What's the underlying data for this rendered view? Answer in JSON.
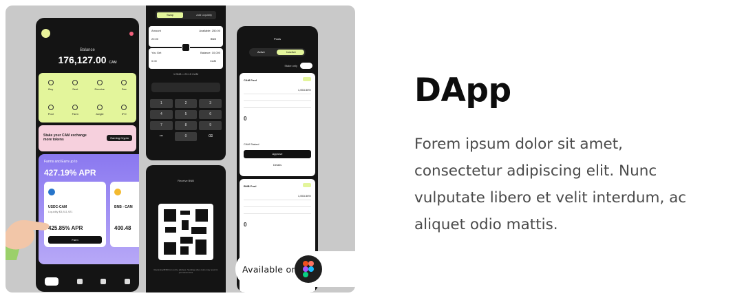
{
  "card": {
    "title": "DApp",
    "description": "Forem ipsum dolor sit amet, consectetur adipiscing elit. Nunc vulputate libero et velit interdum, ac aliquet odio mattis.",
    "available_on": "Available on",
    "available_icon": "figma-icon"
  },
  "wallet": {
    "balance_label": "Balance",
    "balance_value": "176,127.00",
    "balance_unit": "CAM",
    "actions": [
      "Buy",
      "Sent",
      "Receive",
      "Dex",
      "Pool",
      "Farm",
      "Jungle",
      "IFO"
    ],
    "stake_text": "Stake your CAM exchange more tokens",
    "stake_button": "Earning Crypto",
    "farm_heading": "Farms and Earn up to",
    "farm_apr": "427.19% APR",
    "pools": [
      {
        "name": "USDC-CAM",
        "liquidity": "Liquidity $3,811,921",
        "apr": "425.85% APR",
        "button": "Farm"
      },
      {
        "name": "BNB - CAM",
        "liquidity": "",
        "apr": "400.48",
        "button": ""
      }
    ]
  },
  "swap": {
    "tabs": [
      "Swap",
      "Add Liquidity"
    ],
    "from_label": "Amount",
    "from_available": "Available: 250.00",
    "from_value": "20.00",
    "from_token": "BNB",
    "to_label": "You Get",
    "to_balance": "Balance: 10,000",
    "to_value": "0.00",
    "to_token": "CAM",
    "rate": "1 BNB = 20.15 CAM",
    "keys": [
      "1",
      "2",
      "3",
      "4",
      "5",
      "6",
      "7",
      "8",
      "9",
      "•••",
      "0",
      "⌫"
    ]
  },
  "receive": {
    "title": "Receive BNB",
    "note": "Receiving BNB from to the address. Sending other coins may result in permanent loss"
  },
  "pools_screen": {
    "title": "Pools",
    "tabs": [
      "Active",
      "Inactive"
    ],
    "toggle_label": "Stake only",
    "pool_a": {
      "name": "CAM Pool",
      "apr": "1,053.56%",
      "earned": "0",
      "staked_label": "CAM Staked",
      "approve": "Approve",
      "details": "Details"
    },
    "pool_b": {
      "name": "BNB Pool",
      "apr": "1,053.56%",
      "earned": "0"
    }
  },
  "colors": {
    "accent_lime": "#e3f59b",
    "accent_pink": "#f6d0dd",
    "accent_purple": "#8a78f0",
    "phone_bg": "#141414",
    "title_text": "#0d0d0d",
    "body_text": "#4a4a4a"
  }
}
